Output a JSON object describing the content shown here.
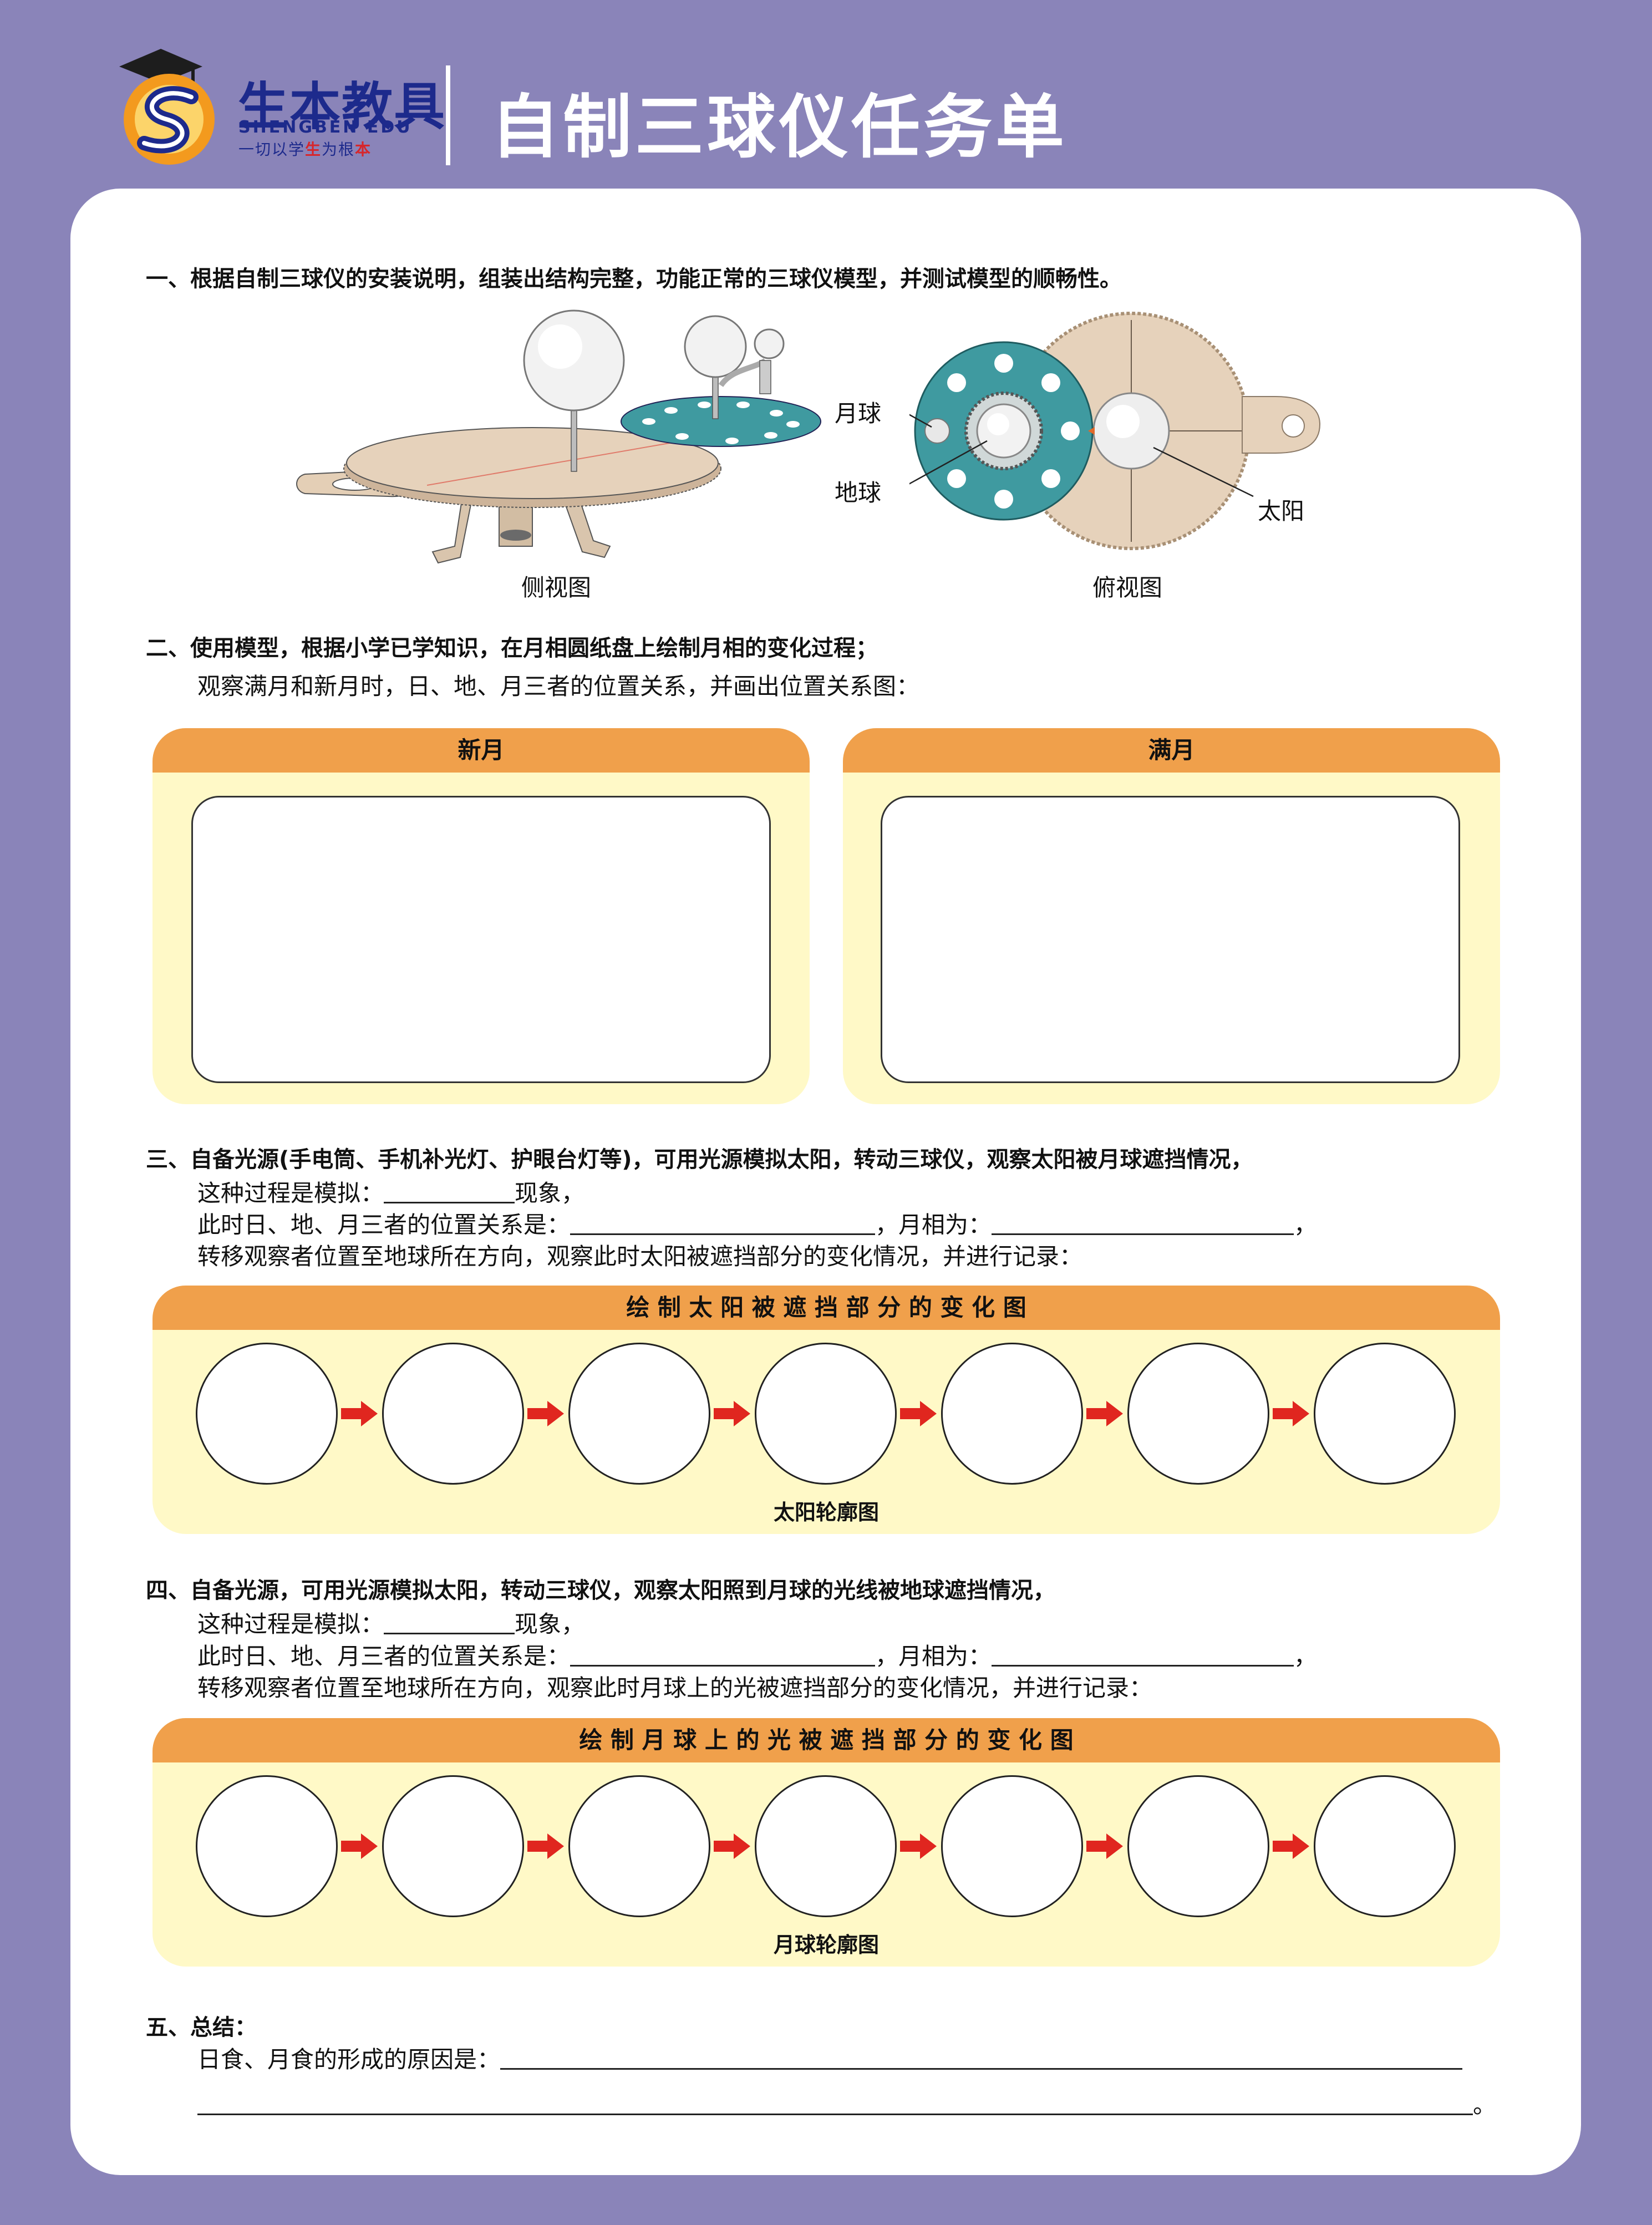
{
  "header": {
    "brand_cn": "生本教具",
    "brand_en": "SHENGBEN EDU",
    "slogan_pre": "一切以学",
    "slogan_hl1": "生",
    "slogan_mid": "为根",
    "slogan_hl2": "本",
    "title": "自制三球仪任务单"
  },
  "section1": {
    "heading": "一、根据自制三球仪的安装说明，组装出结构完整，功能正常的三球仪模型，并测试模型的顺畅性。",
    "side_caption": "侧视图",
    "top_caption": "俯视图",
    "label_moon": "月球",
    "label_earth": "地球",
    "label_sun": "太阳"
  },
  "section2": {
    "heading": "二、使用模型，根据小学已学知识，在月相圆纸盘上绘制月相的变化过程；",
    "sub": "观察满月和新月时，日、地、月三者的位置关系，并画出位置关系图：",
    "card_new": "新月",
    "card_full": "满月"
  },
  "section3": {
    "heading": "三、自备光源(手电筒、手机补光灯、护眼台灯等)，可用光源模拟太阳，转动三球仪，观察太阳被月球遮挡情况，",
    "l1a": "这种过程是模拟：",
    "l1b": "现象，",
    "l2a": "此时日、地、月三者的位置关系是：",
    "l2b": "，月相为：",
    "l2c": "，",
    "l3": "转移观察者位置至地球所在方向，观察此时太阳被遮挡部分的变化情况，并进行记录：",
    "card_title": "绘 制 太 阳 被 遮 挡 部 分 的 变 化 图",
    "card_foot": "太阳轮廓图"
  },
  "section4": {
    "heading": "四、自备光源，可用光源模拟太阳，转动三球仪，观察太阳照到月球的光线被地球遮挡情况，",
    "l1a": "这种过程是模拟：",
    "l1b": "现象，",
    "l2a": "此时日、地、月三者的位置关系是：",
    "l2b": "，月相为：",
    "l2c": "，",
    "l3": "转移观察者位置至地球所在方向，观察此时月球上的光被遮挡部分的变化情况，并进行记录：",
    "card_title": "绘 制 月 球 上 的 光 被 遮 挡 部 分 的 变 化 图",
    "card_foot": "月球轮廓图"
  },
  "section5": {
    "heading": "五、总结：",
    "l1": "日食、月食的形成的原因是：",
    "end": "。"
  },
  "colors": {
    "background": "#8a84b9",
    "card_header": "#f0a04b",
    "card_body": "#fff9c7",
    "arrow": "#e0261f",
    "brand": "#1d2a8c"
  }
}
